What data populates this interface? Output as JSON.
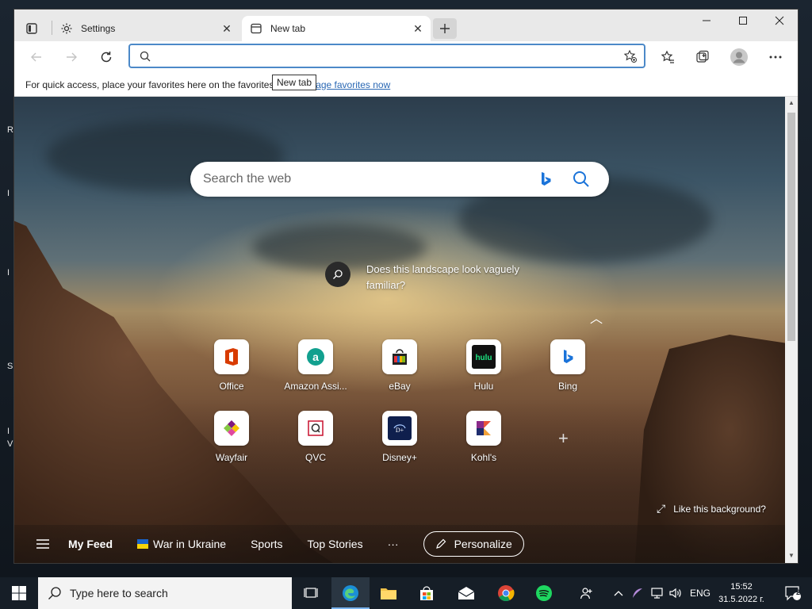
{
  "desktop": {
    "fragments": [
      "Re",
      "I",
      "I",
      "S",
      "I",
      "V"
    ]
  },
  "browser": {
    "tabs": [
      {
        "label": "Settings",
        "icon": "gear-icon"
      },
      {
        "label": "New tab",
        "icon": "newtab-icon",
        "active": true
      }
    ],
    "tooltip": "New tab",
    "address": {
      "value": "",
      "placeholder": ""
    },
    "favbar": {
      "text": "For quick access, place your favorites here on the favorites bar.",
      "link": "Manage favorites now"
    }
  },
  "ntp": {
    "search_placeholder": "Search the web",
    "hint": "Does this landscape look vaguely familiar?",
    "tiles": [
      {
        "label": "Office",
        "icon": "office-icon"
      },
      {
        "label": "Amazon Assi...",
        "icon": "amazon-assistant-icon"
      },
      {
        "label": "eBay",
        "icon": "ebay-icon"
      },
      {
        "label": "Hulu",
        "icon": "hulu-icon"
      },
      {
        "label": "Bing",
        "icon": "bing-icon"
      },
      {
        "label": "Wayfair",
        "icon": "wayfair-icon"
      },
      {
        "label": "QVC",
        "icon": "qvc-icon"
      },
      {
        "label": "Disney+",
        "icon": "disney-plus-icon"
      },
      {
        "label": "Kohl's",
        "icon": "kohls-icon"
      }
    ],
    "like_bg": "Like this background?",
    "feed": {
      "my_feed": "My Feed",
      "items": [
        "War in Ukraine",
        "Sports",
        "Top Stories"
      ],
      "more": "···",
      "personalize": "Personalize"
    }
  },
  "taskbar": {
    "search_placeholder": "Type here to search",
    "lang": "ENG",
    "time": "15:52",
    "date": "31.5.2022 г.",
    "notifications": "2"
  },
  "colors": {
    "accent": "#4c89c8",
    "link": "#2a68b4",
    "taskbar": "#161e27"
  }
}
